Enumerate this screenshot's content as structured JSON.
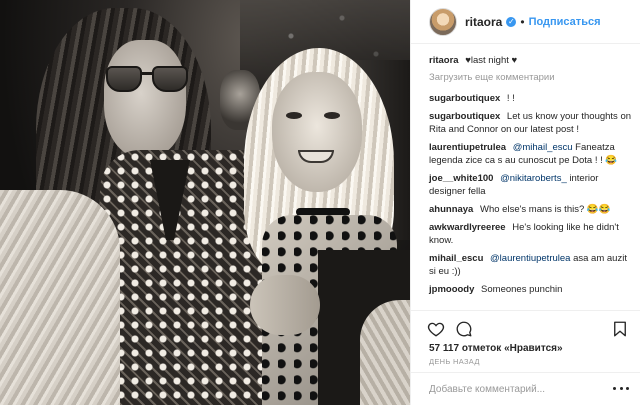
{
  "header": {
    "username": "ritaora",
    "dot": "•",
    "follow_label": "Подписаться"
  },
  "caption": {
    "username": "ritaora",
    "text": "♥last night ♥"
  },
  "load_more_label": "Загрузить еще комментарии",
  "comments": [
    {
      "username": "sugarboutiquex",
      "mention": "",
      "text": "! !"
    },
    {
      "username": "sugarboutiquex",
      "mention": "",
      "text": "Let us know your thoughts on Rita and Connor on our latest post !"
    },
    {
      "username": "laurentiupetrulea",
      "mention": "@mihail_escu",
      "text": "Faneatza legenda zice ca s au cunoscut pe Dota ! ! 😂"
    },
    {
      "username": "joe__white100",
      "mention": "@nikitaroberts_",
      "text": "interior designer fella"
    },
    {
      "username": "ahunnaya",
      "mention": "",
      "text": "Who else's mans is this? 😂😂"
    },
    {
      "username": "awkwardlyreeree",
      "mention": "",
      "text": "He's looking like he didn't know."
    },
    {
      "username": "mihail_escu",
      "mention": "@laurentiupetrulea",
      "text": "asa am auzit si eu :))"
    },
    {
      "username": "jpmooody",
      "mention": "",
      "text": "Someones punchin"
    }
  ],
  "likes": {
    "count": "57 117",
    "word": "отметок",
    "prefix": "«",
    "like_label": "Нравится",
    "suffix": "»"
  },
  "time_label": "день назад",
  "add_comment": {
    "placeholder": "Добавьте комментарий..."
  },
  "icons": {
    "like": "heart-icon",
    "comment": "comment-icon",
    "save": "bookmark-icon",
    "more": "more-options-icon",
    "verified": "verified-badge-icon"
  }
}
